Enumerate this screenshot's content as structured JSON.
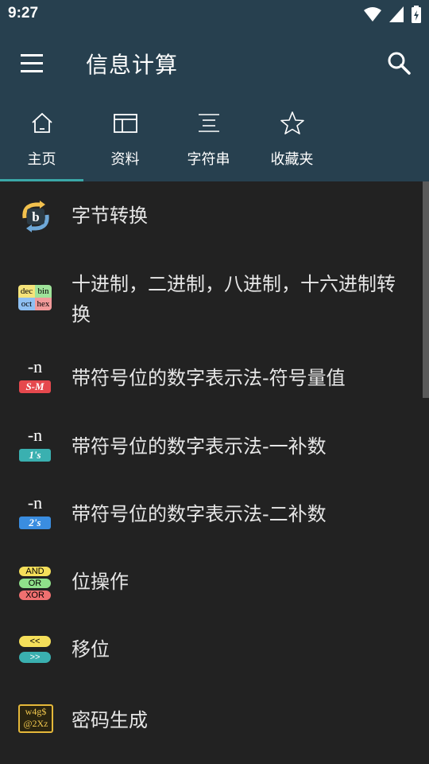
{
  "status": {
    "time": "9:27"
  },
  "appbar": {
    "title": "信息计算",
    "menu_icon": "menu-icon",
    "search_icon": "search-icon"
  },
  "tabs": [
    {
      "label": "主页",
      "icon": "home-icon",
      "active": true
    },
    {
      "label": "资料",
      "icon": "table-icon",
      "active": false
    },
    {
      "label": "字符串",
      "icon": "text-lines-icon",
      "active": false
    },
    {
      "label": "收藏夹",
      "icon": "star-icon",
      "active": false
    }
  ],
  "items": [
    {
      "label": "字节转换",
      "icon": "byte-convert-icon",
      "icon_text": "b"
    },
    {
      "label": "十进制，二进制，八进制，十六进制转换",
      "icon": "base-convert-icon",
      "icon_text": [
        "dec",
        "bin",
        "oct",
        "hex"
      ]
    },
    {
      "label": "带符号位的数字表示法-符号量值",
      "icon": "sign-magnitude-icon",
      "icon_text": [
        "-n",
        "S-M"
      ]
    },
    {
      "label": "带符号位的数字表示法-一补数",
      "icon": "ones-complement-icon",
      "icon_text": [
        "-n",
        "1's"
      ]
    },
    {
      "label": "带符号位的数字表示法-二补数",
      "icon": "twos-complement-icon",
      "icon_text": [
        "-n",
        "2's"
      ]
    },
    {
      "label": "位操作",
      "icon": "bit-operation-icon",
      "icon_text": [
        "AND",
        "OR",
        "XOR"
      ]
    },
    {
      "label": "移位",
      "icon": "bit-shift-icon",
      "icon_text": [
        "<<",
        ">>"
      ]
    },
    {
      "label": "密码生成",
      "icon": "password-icon",
      "icon_text": [
        "w4g$",
        "@2Xz"
      ]
    }
  ],
  "colors": {
    "bar": "#27404f",
    "background": "#222222",
    "accent": "#3aa7a7"
  }
}
